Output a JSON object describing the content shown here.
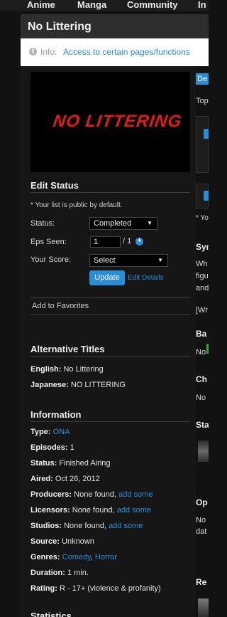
{
  "nav": {
    "anime": "Anime",
    "manga": "Manga",
    "community": "Community",
    "industry": "In"
  },
  "title": "No Littering",
  "info": {
    "prefix": "Info:",
    "link": "Access to certain pages/functions"
  },
  "poster": {
    "text": "NO LITTERING"
  },
  "edit_status": {
    "heading": "Edit Status",
    "note": "* Your list is public by default.",
    "status_label": "Status:",
    "status_value": "Completed",
    "eps_label": "Eps Seen:",
    "eps_value": "1",
    "eps_total": "/ 1",
    "score_label": "Your Score:",
    "score_value": "Select",
    "update": "Update",
    "edit_details": "Edit Details"
  },
  "favorites": "Add to Favorites",
  "alt_titles": {
    "heading": "Alternative Titles",
    "english_label": "English:",
    "english": "No Littering",
    "japanese_label": "Japanese:",
    "japanese": "NO LITTERING"
  },
  "information": {
    "heading": "Information",
    "type_label": "Type:",
    "type": "ONA",
    "episodes_label": "Episodes:",
    "episodes": "1",
    "status_label": "Status:",
    "status": "Finished Airing",
    "aired_label": "Aired:",
    "aired": "Oct 26, 2012",
    "producers_label": "Producers:",
    "producers": "None found,",
    "producers_link": "add some",
    "licensors_label": "Licensors:",
    "licensors": "None found,",
    "licensors_link": "add some",
    "studios_label": "Studios:",
    "studios": "None found,",
    "studios_link": "add some",
    "source_label": "Source:",
    "source": "Unknown",
    "genres_label": "Genres:",
    "genre1": "Comedy",
    "genre_sep": ",",
    "genre2": "Horror",
    "duration_label": "Duration:",
    "duration": "1 min.",
    "rating_label": "Rating:",
    "rating": "R - 17+ (violence & profanity)"
  },
  "statistics": {
    "heading": "Statistics"
  },
  "right_col": {
    "tab": "De",
    "top": "Top",
    "note": "* Yo",
    "syn": "Syn",
    "syn_lines": [
      "Wh",
      "figu",
      "and"
    ],
    "written": "[Wr",
    "bg": "Ba",
    "bg_text": "No",
    "chars": "Ch",
    "chars_text": "No",
    "staff": "Sta",
    "op": "Op",
    "op_lines": [
      "No",
      "dat"
    ],
    "rec": "Re"
  },
  "colors": {
    "accent": "#2c8dd7",
    "poster_text": "#e21a1a",
    "background": "#161616"
  }
}
